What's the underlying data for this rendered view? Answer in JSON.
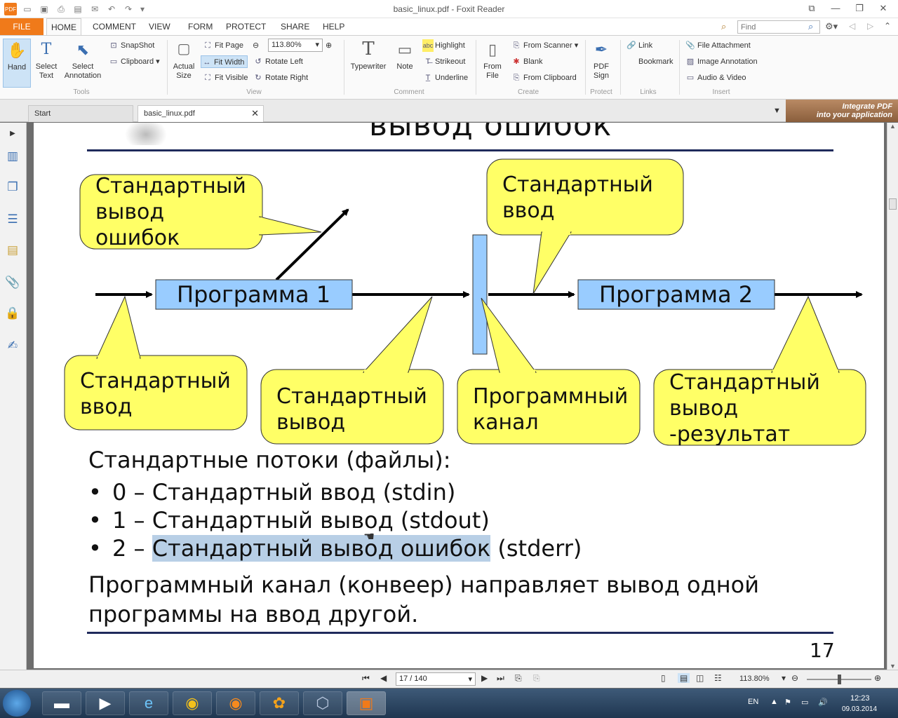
{
  "window": {
    "title": "basic_linux.pdf - Foxit Reader",
    "controls": [
      "⧉",
      "—",
      "❐",
      "✕"
    ]
  },
  "ribbon_tabs": {
    "file": "FILE",
    "tabs": [
      "HOME",
      "COMMENT",
      "VIEW",
      "FORM",
      "PROTECT",
      "SHARE",
      "HELP"
    ],
    "find_placeholder": "Find"
  },
  "ribbon": {
    "tools": {
      "hand": "Hand",
      "select_text": "Select\nText",
      "select_annotation": "Select\nAnnotation",
      "snapshot": "SnapShot",
      "clipboard": "Clipboard",
      "group": "Tools"
    },
    "view": {
      "actual_size": "Actual\nSize",
      "fit_page": "Fit Page",
      "fit_width": "Fit Width",
      "fit_visible": "Fit Visible",
      "zoom_value": "113.80%",
      "rotate_left": "Rotate Left",
      "rotate_right": "Rotate Right",
      "group": "View"
    },
    "comment": {
      "typewriter": "Typewriter",
      "note": "Note",
      "highlight": "Highlight",
      "strikeout": "Strikeout",
      "underline": "Underline",
      "group": "Comment"
    },
    "create": {
      "from_file": "From\nFile",
      "from_scanner": "From Scanner",
      "blank": "Blank",
      "from_clipboard": "From Clipboard",
      "group": "Create"
    },
    "protect": {
      "pdf_sign": "PDF\nSign",
      "group": "Protect"
    },
    "links": {
      "link": "Link",
      "bookmark": "Bookmark",
      "group": "Links"
    },
    "insert": {
      "file_attachment": "File Attachment",
      "image_annotation": "Image Annotation",
      "audio_video": "Audio & Video",
      "group": "Insert"
    }
  },
  "doc_tabs": {
    "start": "Start",
    "current": "basic_linux.pdf",
    "banner": [
      "Integrate PDF",
      "into your application"
    ]
  },
  "pdf_page": {
    "heading": "вывод ошибок",
    "diagram": {
      "callout_stderr": [
        "Стандартный",
        "вывод",
        "ошибок"
      ],
      "callout_stdin_top": [
        "Стандартный",
        "ввод"
      ],
      "program1": "Программа 1",
      "program2": "Программа 2",
      "callout_stdin_bottom": [
        "Стандартный",
        "ввод"
      ],
      "callout_stdout": [
        "Стандартный",
        "вывод"
      ],
      "callout_pipe": [
        "Программный",
        "канал"
      ],
      "callout_result": [
        "Стандартный",
        "вывод",
        "-результат"
      ]
    },
    "streams_title": "Стандартные потоки (файлы):",
    "bullet_0": "0 – Стандартный ввод (stdin)",
    "bullet_1": "1 – Стандартный вывод (stdout)",
    "bullet_2_prefix": "2 – ",
    "bullet_2_highlight": "Стандартный вывод ошибок",
    "bullet_2_suffix": " (stderr)",
    "pipe_line1": "Программный канал (конвеер) направляет вывод одной",
    "pipe_line2": "программы на ввод другой.",
    "page_number": "17"
  },
  "status_bar": {
    "page_field": "17 / 140",
    "zoom": "113.80%"
  },
  "taskbar": {
    "language": "EN",
    "time": "12:23",
    "date": "09.03.2014"
  },
  "colors": {
    "accent": "#f07a1a",
    "callout_fill": "#ffff66",
    "program_box": "#99ccff",
    "highlight": "#b8cfe6",
    "rule": "#1f2a5c"
  }
}
